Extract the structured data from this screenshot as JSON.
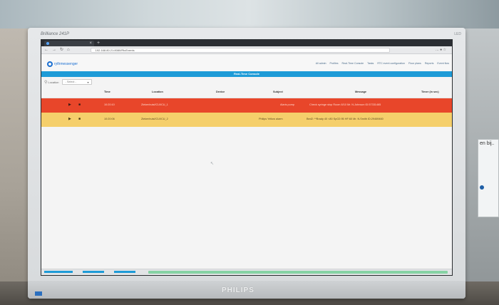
{
  "monitor": {
    "brand": "Brilliance 241P",
    "model": "LED",
    "logo": "PHILIPS"
  },
  "side_paper": {
    "line1": "en bij..",
    "line2": "..."
  },
  "browser": {
    "tab_title": "",
    "url": "192.168.80.21:8080/RtcEvents",
    "nav_icons": [
      "back-icon",
      "forward-icon",
      "reload-icon",
      "home-icon"
    ],
    "tools": "… ● ☆"
  },
  "app": {
    "logo_text": "rythmessenger",
    "topnav": [
      "All admin",
      "Profiles",
      "Real-Time Console",
      "Tasks",
      "RTC event configuration",
      "Floor plans",
      "Reports",
      "Event flow"
    ],
    "section_title": "Real-Time Console",
    "filter": {
      "label": "Location",
      "select_value": "- Select -"
    },
    "table": {
      "headers": [
        "Time",
        "Location",
        "Device",
        "Subject",
        "Message",
        "Timer (in sec)"
      ],
      "rows": [
        {
          "time": "10:20:10",
          "location": "Ziekenhuis/ICU/ICU_1",
          "device": "",
          "subject": "Alaris pump",
          "message": "Check syringe stop Room 8/10 Mr. N.Johnson ID:57331465",
          "timer": "",
          "severity": "red"
        },
        {
          "time": "10:20:06",
          "location": "Ziekenhuis/ICU/ICU_2",
          "device": "",
          "subject": "Philips Yellow alarm",
          "message": "Bed2: **Brady 40 <80 SpO2:95 HF:60 Mr. N.Smith ID:29469460",
          "timer": "",
          "severity": "yellow"
        }
      ]
    }
  },
  "colors": {
    "accent": "#1e9bd7",
    "red_row": "#e8462a",
    "yellow_row": "#f5cf6b",
    "brand_blue": "#1b6fd1"
  }
}
